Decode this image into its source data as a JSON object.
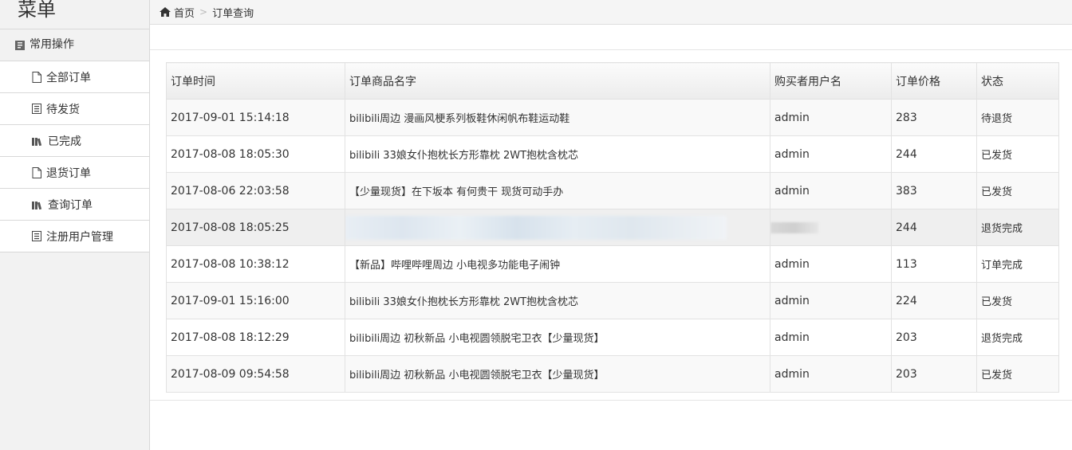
{
  "sidebar": {
    "title": "菜单",
    "section": "常用操作",
    "items": [
      {
        "label": "全部订单",
        "icon": "file-icon"
      },
      {
        "label": "待发货",
        "icon": "list-icon"
      },
      {
        "label": "已完成",
        "icon": "books-icon"
      },
      {
        "label": "退货订单",
        "icon": "file-icon"
      },
      {
        "label": "查询订单",
        "icon": "books-icon"
      },
      {
        "label": "注册用户管理",
        "icon": "list-icon"
      }
    ]
  },
  "breadcrumb": {
    "home": "首页",
    "current": "订单查询"
  },
  "table": {
    "columns": [
      "订单时间",
      "订单商品名字",
      "购买者用户名",
      "订单价格",
      "状态"
    ],
    "rows": [
      {
        "time": "2017-09-01 15:14:18",
        "product": "bilibili周边 漫画风梗系列板鞋休闲帆布鞋运动鞋",
        "user": "admin",
        "price": "283",
        "status": "待退货"
      },
      {
        "time": "2017-08-08 18:05:30",
        "product": "bilibili 33娘女仆抱枕长方形靠枕 2WT抱枕含枕芯",
        "user": "admin",
        "price": "244",
        "status": "已发货"
      },
      {
        "time": "2017-08-06 22:03:58",
        "product": "【少量现货】在下坂本 有何贵干 现货可动手办",
        "user": "admin",
        "price": "383",
        "status": "已发货"
      },
      {
        "time": "2017-08-08 18:05:25",
        "product": "",
        "user": "",
        "price": "244",
        "status": "退货完成"
      },
      {
        "time": "2017-08-08 10:38:12",
        "product": "【新品】哔哩哔哩周边 小电视多功能电子闹钟",
        "user": "admin",
        "price": "113",
        "status": "订单完成"
      },
      {
        "time": "2017-09-01 15:16:00",
        "product": "bilibili 33娘女仆抱枕长方形靠枕 2WT抱枕含枕芯",
        "user": "admin",
        "price": "224",
        "status": "已发货"
      },
      {
        "time": "2017-08-08 18:12:29",
        "product": "bilibili周边 初秋新品 小电视圆领脱宅卫衣【少量现货】",
        "user": "admin",
        "price": "203",
        "status": "退货完成"
      },
      {
        "time": "2017-08-09 09:54:58",
        "product": "bilibili周边 初秋新品 小电视圆领脱宅卫衣【少量现货】",
        "user": "admin",
        "price": "203",
        "status": "已发货"
      }
    ]
  },
  "colors": {
    "status": "#e03a3a",
    "product": "#4a6b5a"
  }
}
